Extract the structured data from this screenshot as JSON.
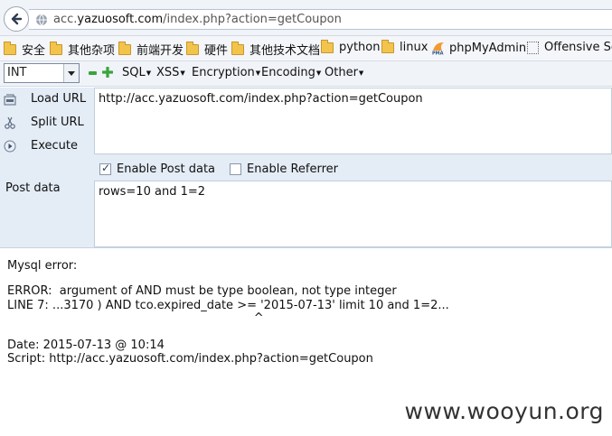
{
  "address_bar": {
    "url_prefix": "acc.",
    "url_host": "yazuosoft.com",
    "url_path": "/index.php?action=getCoupon"
  },
  "bookmarks": [
    {
      "label": "安全",
      "icon": "folder-icon"
    },
    {
      "label": "其他杂项",
      "icon": "folder-icon"
    },
    {
      "label": "前端开发",
      "icon": "folder-icon"
    },
    {
      "label": "硬件",
      "icon": "folder-icon"
    },
    {
      "label": "其他技术文档",
      "icon": "folder-icon"
    },
    {
      "label": "python",
      "icon": "folder-icon"
    },
    {
      "label": "linux",
      "icon": "folder-icon"
    },
    {
      "label": "phpMyAdmin",
      "icon": "phpmyadmin-icon"
    },
    {
      "label": "Offensive Sec",
      "icon": "page-icon"
    }
  ],
  "hackbar": {
    "type_select": "INT",
    "menus": [
      "SQL",
      "XSS",
      "Encryption",
      "Encoding",
      "Other"
    ],
    "actions": {
      "load_url": "Load URL",
      "split_url": "Split URL",
      "execute": "Execute"
    },
    "url_value": "http://acc.yazuosoft.com/index.php?action=getCoupon",
    "enable_post": {
      "label": "Enable Post data",
      "checked": true
    },
    "enable_referrer": {
      "label": "Enable Referrer",
      "checked": false
    },
    "post_label": "Post data",
    "post_value": "rows=10 and 1=2"
  },
  "content": {
    "line1": "Mysql error:",
    "line2": "ERROR:  argument of AND must be type boolean, not type integer",
    "line3": "LINE 7: ...3170 ) AND tco.expired_date >= '2015-07-13' limit 10 and 1=2...",
    "line4": "                                                                  ^",
    "line5": "Date: 2015-07-13 @ 10:14",
    "line6": "Script: http://acc.yazuosoft.com/index.php?action=getCoupon"
  },
  "watermark": "www.wooyun.org",
  "colors": {
    "chrome_bg": "#f0f3f8",
    "hackbar_bg": "#e4ecf6",
    "folder": "#f2c44c",
    "accent_green": "#39a53a"
  }
}
